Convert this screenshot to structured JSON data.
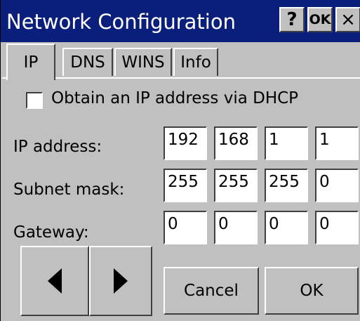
{
  "window": {
    "title": "Network Configuration",
    "help_label": "?",
    "ok_label": "OK",
    "close_label": "×"
  },
  "tabs": [
    {
      "label": "IP",
      "selected": true
    },
    {
      "label": "DNS",
      "selected": false
    },
    {
      "label": "WINS",
      "selected": false
    },
    {
      "label": "Info",
      "selected": false
    }
  ],
  "dhcp": {
    "label": "Obtain an IP address via DHCP",
    "checked": false
  },
  "fields": [
    {
      "label": "IP address:",
      "octets": [
        "192",
        "168",
        "1",
        "1"
      ]
    },
    {
      "label": "Subnet mask:",
      "octets": [
        "255",
        "255",
        "255",
        "0"
      ]
    },
    {
      "label": "Gateway:",
      "octets": [
        "0",
        "0",
        "0",
        "0"
      ]
    }
  ],
  "buttons": {
    "prev_icon": "left-arrow-icon",
    "next_icon": "right-arrow-icon",
    "cancel_label": "Cancel",
    "ok_label": "OK"
  }
}
